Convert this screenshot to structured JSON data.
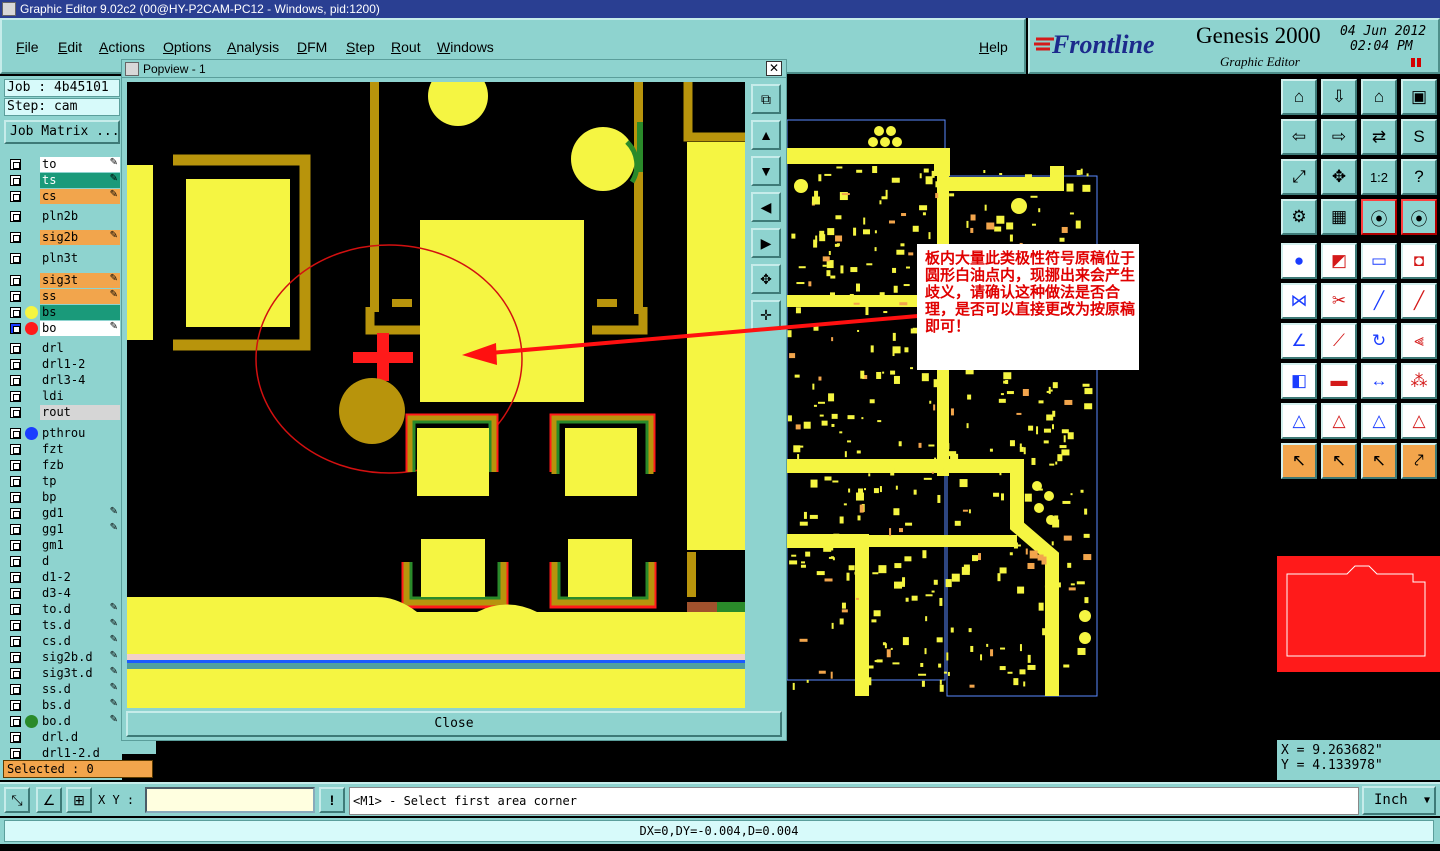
{
  "window": {
    "title": "Graphic Editor 9.02c2 (00@HY-P2CAM-PC12 - Windows, pid:1200)"
  },
  "menu": {
    "items": [
      "File",
      "Edit",
      "Actions",
      "Options",
      "Analysis",
      "DFM",
      "Step",
      "Rout",
      "Windows"
    ],
    "help": "Help"
  },
  "brand": {
    "logo": "Frontline",
    "product": "Genesis 2000",
    "subtitle": "Graphic Editor",
    "date": "04 Jun 2012",
    "time": "02:04 PM"
  },
  "job": {
    "job_label": "Job : 4b45101",
    "step_label": "Step: cam",
    "matrix_button": "Job Matrix ..."
  },
  "layers": [
    {
      "name": "to",
      "color": "#ffffff",
      "edit": true
    },
    {
      "name": "ts",
      "color": "#1a9a7a",
      "text": "#ffffff",
      "edit": true
    },
    {
      "name": "cs",
      "color": "#f2a54c",
      "edit": true
    },
    {
      "name": "pln2b",
      "color": "#8ed3cf"
    },
    {
      "name": "sig2b",
      "color": "#f2a54c",
      "edit": true
    },
    {
      "name": "pln3t",
      "color": "#8ed3cf"
    },
    {
      "name": "sig3t",
      "color": "#f2a54c",
      "edit": true
    },
    {
      "name": "ss",
      "color": "#f2a54c",
      "edit": true
    },
    {
      "name": "bs",
      "color": "#1a9a7a",
      "dot": "#f5f542"
    },
    {
      "name": "bo",
      "color": "#ffffff",
      "dot": "#ff1a1a",
      "edit": true,
      "selected": true
    },
    {
      "name": "drl",
      "color": "#8ed3cf"
    },
    {
      "name": "drl1-2",
      "color": "#8ed3cf"
    },
    {
      "name": "drl3-4",
      "color": "#8ed3cf"
    },
    {
      "name": "ldi",
      "color": "#8ed3cf"
    },
    {
      "name": "rout",
      "color": "#d6d6d6"
    },
    {
      "name": "pthrou",
      "color": "#8ed3cf",
      "dot": "#1a3cff"
    },
    {
      "name": "fzt",
      "color": "#8ed3cf"
    },
    {
      "name": "fzb",
      "color": "#8ed3cf"
    },
    {
      "name": "tp",
      "color": "#8ed3cf"
    },
    {
      "name": "bp",
      "color": "#8ed3cf"
    },
    {
      "name": "gd1",
      "color": "#8ed3cf",
      "edit": true
    },
    {
      "name": "gg1",
      "color": "#8ed3cf",
      "edit": true
    },
    {
      "name": "gm1",
      "color": "#8ed3cf"
    },
    {
      "name": "d",
      "color": "#8ed3cf"
    },
    {
      "name": "d1-2",
      "color": "#8ed3cf"
    },
    {
      "name": "d3-4",
      "color": "#8ed3cf"
    },
    {
      "name": "to.d",
      "color": "#8ed3cf",
      "edit": true
    },
    {
      "name": "ts.d",
      "color": "#8ed3cf",
      "edit": true
    },
    {
      "name": "cs.d",
      "color": "#8ed3cf",
      "edit": true
    },
    {
      "name": "sig2b.d",
      "color": "#8ed3cf",
      "edit": true
    },
    {
      "name": "sig3t.d",
      "color": "#8ed3cf",
      "edit": true
    },
    {
      "name": "ss.d",
      "color": "#8ed3cf",
      "edit": true
    },
    {
      "name": "bs.d",
      "color": "#8ed3cf",
      "edit": true
    },
    {
      "name": "bo.d",
      "color": "#8ed3cf",
      "dot": "#2a8a2a",
      "edit": true
    },
    {
      "name": "drl.d",
      "color": "#8ed3cf"
    },
    {
      "name": "drl1-2.d",
      "color": "#8ed3cf"
    }
  ],
  "selected": "Selected : 0",
  "popview": {
    "title": "Popview - 1",
    "close": "Close"
  },
  "annotation": "板内大量此类极性符号原稿位于圆形白油点内，现挪出来会产生歧义，请确认这种做法是否合理，是否可以直接更改为按原稿即可！",
  "coords": {
    "x": "X = 9.263682\"",
    "y": "Y = 4.133978\""
  },
  "cmd": {
    "xy_label": "X Y :",
    "xy_value": "",
    "prompt": "<M1> - Select first area corner",
    "units": "Inch"
  },
  "status": "DX=0,DY=-0.004,D=0.004",
  "tools_icons": [
    "home-icon",
    "down-icon",
    "house-icon",
    "window-icon",
    "left-icon",
    "right-icon",
    "swap-icon",
    "s-icon",
    "fit-icon",
    "center-icon",
    "ratio-icon",
    "question-icon",
    "tools-icon",
    "grid-icon",
    "traffic-icon",
    "traffic2-icon",
    "pad-icon",
    "board-icon",
    "ruler-icon",
    "box-icon",
    "net-icon",
    "cut-icon",
    "line-icon",
    "line2-icon",
    "angle-icon",
    "slash-icon",
    "curve-icon",
    "ff-icon",
    "sq-icon",
    "bar-icon",
    "dim-icon",
    "group-icon",
    "tri-icon",
    "tri2-icon",
    "tri3-icon",
    "tri4-icon",
    "arrow-icon",
    "arrow2-icon",
    "arrow3-icon",
    "arrow4-icon"
  ],
  "tools_labels": {
    "ratio": "1:2"
  }
}
